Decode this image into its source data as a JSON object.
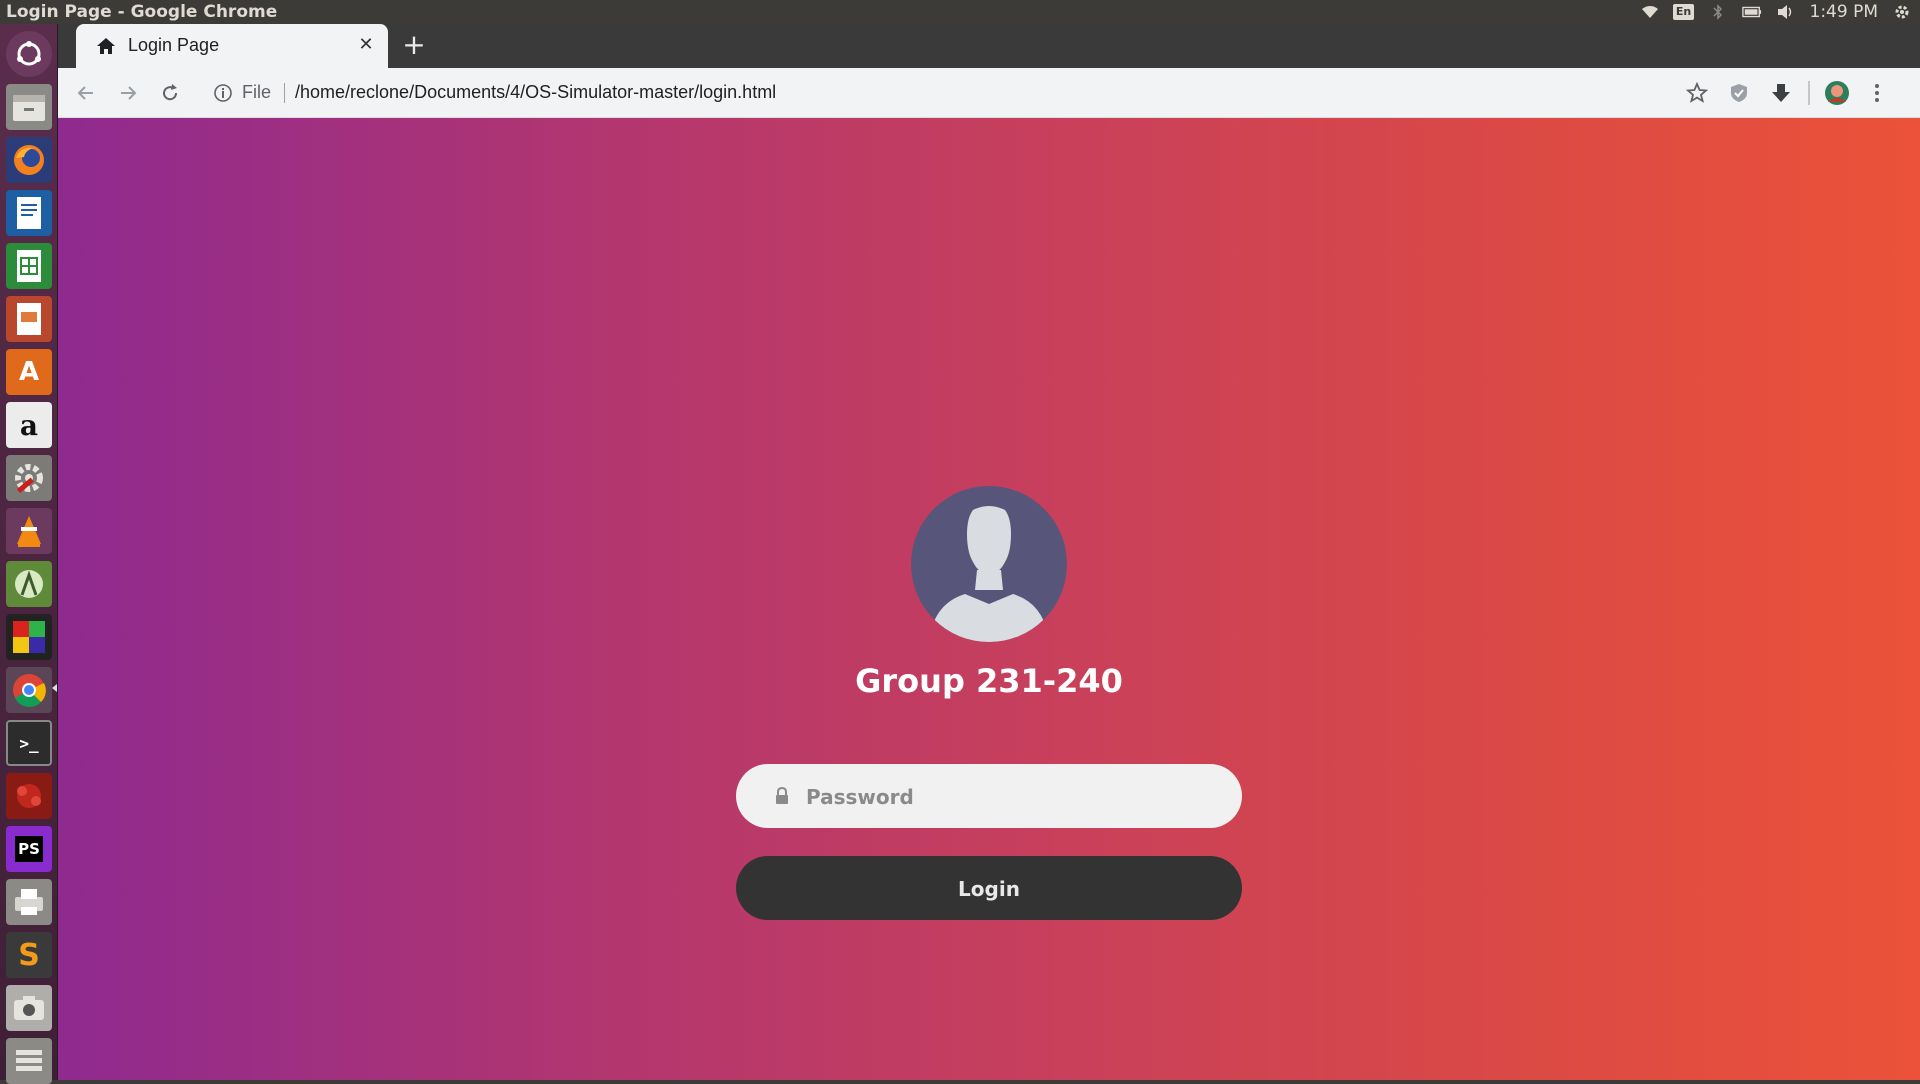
{
  "window": {
    "title": "Login Page - Google Chrome"
  },
  "tray": {
    "keyboard": "En",
    "clock": "1:49 PM"
  },
  "launcher": {
    "apps": [
      {
        "name": "dash-home-icon"
      },
      {
        "name": "files-icon"
      },
      {
        "name": "firefox-icon"
      },
      {
        "name": "libreoffice-writer-icon"
      },
      {
        "name": "libreoffice-calc-icon"
      },
      {
        "name": "libreoffice-impress-icon"
      },
      {
        "name": "ubuntu-software-icon"
      },
      {
        "name": "amazon-icon"
      },
      {
        "name": "system-settings-icon"
      },
      {
        "name": "vlc-icon"
      },
      {
        "name": "android-studio-icon"
      },
      {
        "name": "colorful-app-icon"
      },
      {
        "name": "chrome-icon"
      },
      {
        "name": "terminal-icon"
      },
      {
        "name": "wine-icon"
      },
      {
        "name": "phpstorm-icon"
      },
      {
        "name": "printer-icon"
      },
      {
        "name": "sublime-text-icon"
      },
      {
        "name": "camera-icon"
      },
      {
        "name": "trash-stack-icon"
      }
    ]
  },
  "browser": {
    "tab_title": "Login Page",
    "omnibox": {
      "scheme_label": "File",
      "url": "/home/reclone/Documents/4/OS-Simulator-master/login.html"
    }
  },
  "page": {
    "heading": "Group 231-240",
    "password_placeholder": "Password",
    "login_label": "Login",
    "colors": {
      "gradient_left": "#8f2a8f",
      "gradient_right": "#ec5239",
      "button": "#333333",
      "avatar_bg": "#58557a"
    }
  }
}
